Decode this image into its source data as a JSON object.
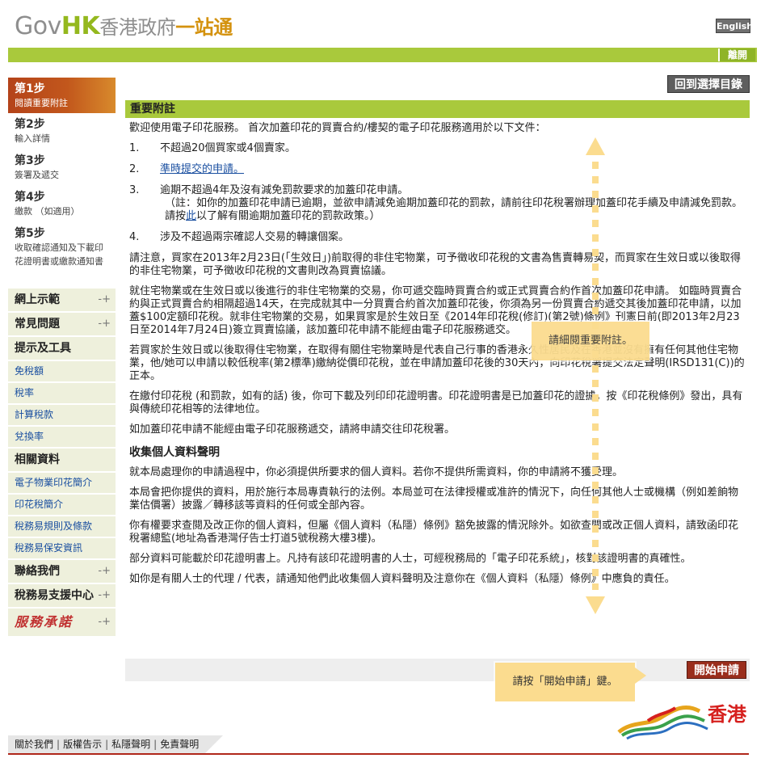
{
  "header": {
    "logo_gov": "Gov",
    "logo_hk": "HK",
    "logo_cn": "香港政府",
    "logo_one": "一站通",
    "lang_label": "English",
    "logout_label": "離開"
  },
  "sidebar": {
    "steps": [
      {
        "num": "第1步",
        "desc": "閱讀重要附註",
        "active": true
      },
      {
        "num": "第2步",
        "desc": "輸入詳情"
      },
      {
        "num": "第3步",
        "desc": "簽署及遞交"
      },
      {
        "num": "第4步",
        "desc": "繳款 （如適用）"
      },
      {
        "num": "第5步",
        "desc": "收取確認通知及下載印花證明書或繳款通知書"
      }
    ],
    "nav": {
      "demo": "網上示範",
      "faq": "常見問題",
      "tips_tools": "提示及工具",
      "tools": [
        "免稅額",
        "稅率",
        "計算稅款",
        "兌換率"
      ],
      "related": "相關資料",
      "related_links": [
        "電子物業印花簡介",
        "印花稅簡介",
        "稅務易規則及條款",
        "稅務易保安資訊"
      ],
      "contact": "聯絡我們",
      "support": "稅務易支援中心",
      "service": "服務承諾"
    }
  },
  "main": {
    "back_label": "回到選擇目錄",
    "section_title": "重要附註",
    "intro": "歡迎使用電子印花服務。 首次加蓋印花的買賣合約/樓契的電子印花服務適用於以下文件：",
    "items": [
      {
        "n": "1.",
        "text": "不超過20個買家或4個賣家。"
      },
      {
        "n": "2.",
        "link": "準時提交的申請。"
      },
      {
        "n": "3.",
        "text": "逾期不超過4年及沒有減免罰款要求的加蓋印花申請。",
        "note_pre": "（註：如你的加蓋印花申請已逾期，並欲申請減免逾期加蓋印花的罰款，請前往印花稅署辦理加蓋印花手續及申請減免罰款。請按",
        "note_link": "此",
        "note_post": "以了解有關逾期加蓋印花的罰款政策。）"
      },
      {
        "n": "4.",
        "text": "涉及不超過兩宗確認人交易的轉讓個案。"
      }
    ],
    "para1": "請注意，買家在2013年2月23日(「生效日」)前取得的非住宅物業，可予徵收印花稅的文書為售賣轉易契，而買家在生效日或以後取得的非住宅物業，可予徵收印花稅的文書則改為買賣協議。",
    "para2": "就住宅物業或在生效日或以後進行的非住宅物業的交易，你可遞交臨時買賣合約或正式買賣合約作首次加蓋印花申請。 如臨時買賣合約與正式買賣合約相隔超過14天，在完成就其中一分買賣合約首次加蓋印花後，你須為另一份買賣合約遞交其後加蓋印花申請，以加蓋$100定額印花稅。就非住宅物業的交易，如果買家是於生效日至《2014年印花稅(修訂)(第2號)條例》刊憲日前(即2013年2月23日至2014年7月24日)簽立買賣協議，該加蓋印花申請不能經由電子印花服務遞交。",
    "para3": "若買家於生效日或以後取得住宅物業，在取得有關住宅物業時是代表自己行事的香港永久性居民及在香港並沒有擁有任何其他住宅物業，他/她可以申請以較低稅率(第2標準)繳納從價印花稅，並在申請加蓋印花後的30天內，向印花稅署提交法定聲明(IRSD131(C))的正本。",
    "para4": "在繳付印花稅 (和罰款，如有的話) 後，你可下載及列印印花證明書。印花證明書是已加蓋印花的證據，按《印花稅條例》發出，具有與傳統印花相等的法律地位。",
    "para5": "如加蓋印花申請不能經由電子印花服務遞交，請將申請交往印花稅署。",
    "pics_title": "收集個人資料聲明",
    "pics1": "就本局處理你的申請過程中，你必須提供所要求的個人資料。若你不提供所需資料，你的申請將不獲受理。",
    "pics2": "本局會把你提供的資料，用於施行本局專責執行的法例。本局並可在法律授權或准許的情況下，向任何其他人士或機構（例如差餉物業估價署）披露／轉移該等資料的任何或全部內容。",
    "pics3": "你有權要求查閱及改正你的個人資料，但屬《個人資料（私隱）條例》豁免披露的情況除外。如欲查閱或改正個人資料，請致函印花稅署總監(地址為香港灣仔告士打道5號稅務大樓3樓)。",
    "pics4": "部分資料可能載於印花證明書上。凡持有該印花證明書的人士，可經稅務局的「電子印花系統」，核對該證明書的真確性。",
    "pics5": "如你是有關人士的代理 / 代表，請通知他們此收集個人資料聲明及注意你在《個人資料（私隱）條例》中應負的責任。",
    "start_label": "開始申請"
  },
  "tips": {
    "read_notes": "請細閱重要附註。",
    "press_start": "請按「開始申請」鍵。"
  },
  "footer": {
    "links": [
      "關於我們",
      "版權告示",
      "私隱聲明",
      "免責聲明"
    ],
    "brand": "香港"
  },
  "colors": {
    "green": "#a9c93c",
    "step_active": "#c2571c",
    "start_button": "#9a2e1c",
    "tip": "#fbdc8f"
  }
}
